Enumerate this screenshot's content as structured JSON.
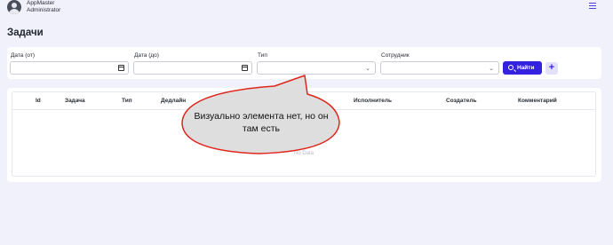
{
  "header": {
    "user_name": "AppMaster",
    "user_role": "Administrator"
  },
  "page": {
    "title": "Задачи"
  },
  "filters": {
    "date_from_label": "Дата (от)",
    "date_to_label": "Дата (до)",
    "type_label": "Тип",
    "employee_label": "Сотрудник",
    "find_button": "Найти",
    "add_button": "+"
  },
  "table": {
    "columns": [
      "Id",
      "Задача",
      "Тип",
      "Дедлайн",
      "Исполнитель",
      "Создатель",
      "Комментарий"
    ],
    "empty_text": "No Data"
  },
  "annotation": {
    "text": "Визуально элемента нет, но он там есть"
  },
  "colors": {
    "accent": "#3522e0",
    "background": "#f1f1fb",
    "bubble_fill": "#dedede",
    "bubble_border": "#e0251b"
  }
}
